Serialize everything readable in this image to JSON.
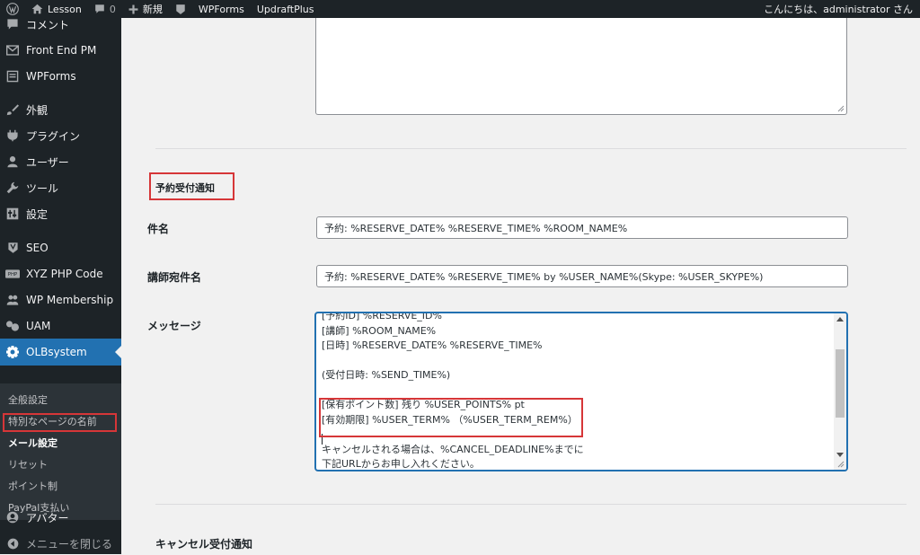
{
  "adminbar": {
    "site_name": "Lesson",
    "comments_count": "0",
    "new_label": "新規",
    "wpforms_label": "WPForms",
    "updraft_label": "UpdraftPlus",
    "greeting": "こんにちは、administrator さん"
  },
  "sidebar": {
    "items": [
      {
        "label": "コメント",
        "icon": "comment-icon"
      },
      {
        "label": "Front End PM",
        "icon": "envelope-icon"
      },
      {
        "label": "WPForms",
        "icon": "form-icon"
      },
      {
        "label": "外観",
        "icon": "paintbrush-icon"
      },
      {
        "label": "プラグイン",
        "icon": "plugin-icon"
      },
      {
        "label": "ユーザー",
        "icon": "user-icon"
      },
      {
        "label": "ツール",
        "icon": "wrench-icon"
      },
      {
        "label": "設定",
        "icon": "settings-icon"
      },
      {
        "label": "SEO",
        "icon": "yoast-icon"
      },
      {
        "label": "XYZ PHP Code",
        "icon": "php-icon"
      },
      {
        "label": "WP Membership",
        "icon": "membership-icon"
      },
      {
        "label": "UAM",
        "icon": "uam-icon"
      },
      {
        "label": "OLBsystem",
        "icon": "gear-icon"
      }
    ],
    "submenu": [
      "全般設定",
      "特別なページの名前",
      "メール設定",
      "リセット",
      "ポイント制",
      "PayPal支払い"
    ],
    "avatar_label": "アバター",
    "collapse_label": "メニューを閉じる"
  },
  "content": {
    "section_reserve_title": "予約受付通知",
    "subject_label": "件名",
    "subject_value": "予約: %RESERVE_DATE% %RESERVE_TIME% %ROOM_NAME%",
    "teacher_subject_label": "講師宛件名",
    "teacher_subject_value": "予約: %RESERVE_DATE% %RESERVE_TIME% by %USER_NAME%(Skype: %USER_SKYPE%)",
    "message_label": "メッセージ",
    "message_lines": [
      "[予約ID] %RESERVE_ID%",
      "[講師] %ROOM_NAME%",
      "[日時] %RESERVE_DATE% %RESERVE_TIME%",
      "",
      "(受付日時: %SEND_TIME%)",
      "",
      "[保有ポイント数] 残り %USER_POINTS% pt",
      "[有効期限] %USER_TERM% （%USER_TERM_REM%）",
      "",
      "キャンセルされる場合は、%CANCEL_DEADLINE%までに",
      "下記URLからお申し入れください。"
    ],
    "section_cancel_title": "キャンセル受付通知"
  }
}
